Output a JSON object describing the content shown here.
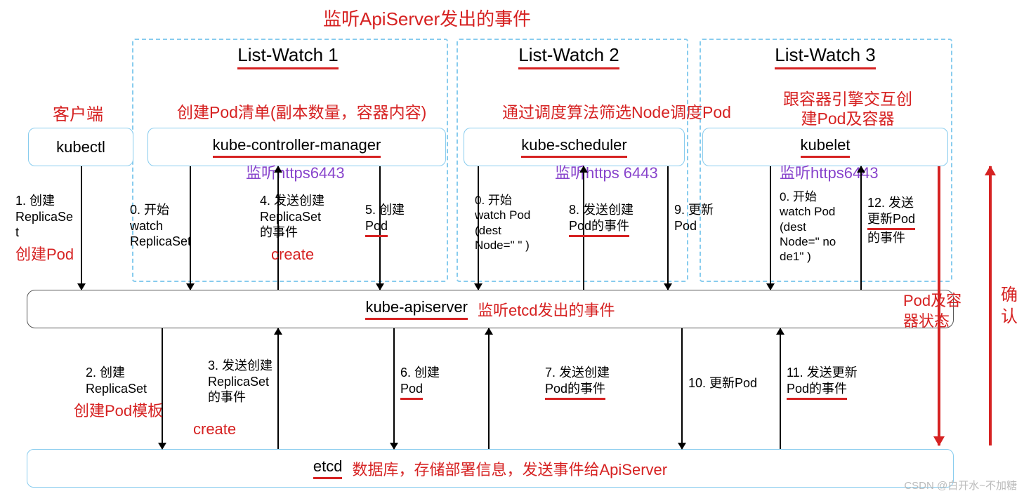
{
  "title_top": "监听ApiServer发出的事件",
  "listwatch": {
    "lw1": "List-Watch 1",
    "lw2": "List-Watch 2",
    "lw3": "List-Watch 3"
  },
  "client_label": "客户端",
  "kubectl": "kubectl",
  "kcm": {
    "name": "kube-controller-manager",
    "desc": "创建Pod清单(副本数量，容器内容)",
    "listen": "监听https6443"
  },
  "ksched": {
    "name": "kube-scheduler",
    "desc": "通过调度算法筛选Node调度Pod",
    "listen": "监听https 6443"
  },
  "kubelet": {
    "name": "kubelet",
    "desc": "跟容器引擎交互创建Pod及容器",
    "listen": "监听https6443"
  },
  "apiserver": {
    "name": "kube-apiserver",
    "note": "监听etcd发出的事件"
  },
  "etcd": {
    "name": "etcd",
    "note": "数据库，存储部署信息，发送事件给ApiServer"
  },
  "steps": {
    "s1": "1. 创建\nReplicaSe\nt",
    "s1_red": "创建Pod",
    "s0a": "0. 开始\nwatch\nReplicaSet",
    "s4": "4. 发送创建\nReplicaSet\n的事件",
    "s4_red": "create",
    "s5": "5. 创建\nPod",
    "s0b": "0. 开始\nwatch Pod\n(dest\nNode=\" \" )",
    "s8": "8. 发送创建\nPod的事件",
    "s9": "9. 更新\nPod",
    "s0c": "0. 开始\nwatch Pod\n(dest\nNode=\" no\nde1\" )",
    "s12": "12. 发送\n更新Pod\n的事件",
    "s2": "2. 创建\nReplicaSet",
    "s2_red": "创建Pod模板",
    "s3": "3. 发送创建\nReplicaSet\n的事件",
    "s3_red": "create",
    "s6": "6. 创建\nPod",
    "s7": "7. 发送创建\nPod的事件",
    "s10": "10. 更新Pod",
    "s11": "11. 发送更新\nPod的事件"
  },
  "pod_status": "Pod及容\n器状态",
  "confirm": "确\n认",
  "watermark": "CSDN @白开水~不加糖"
}
